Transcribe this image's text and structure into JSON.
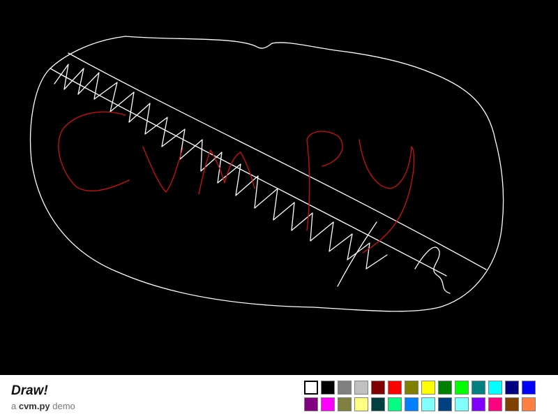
{
  "app": {
    "title": "Draw!",
    "subtitle_prefix": "a ",
    "subtitle_name": "cvm.py",
    "subtitle_suffix": " demo"
  },
  "canvas": {
    "background": "#000000",
    "stroke_colors": {
      "white": "#ffffff",
      "red": "#d01010"
    }
  },
  "palette": {
    "selected": "#ffffff",
    "colors": [
      "#ffffff",
      "#000000",
      "#808080",
      "#c0c0c0",
      "#800000",
      "#ff0000",
      "#808000",
      "#ffff00",
      "#008000",
      "#00ff00",
      "#008080",
      "#00ffff",
      "#000080",
      "#0000ff",
      "#800080",
      "#ff00ff",
      "#808040",
      "#ffff80",
      "#004040",
      "#00ff80",
      "#0080ff",
      "#80ffff",
      "#004080",
      "#80ffff",
      "#8000ff",
      "#ff0080",
      "#804000",
      "#ff8040"
    ]
  }
}
